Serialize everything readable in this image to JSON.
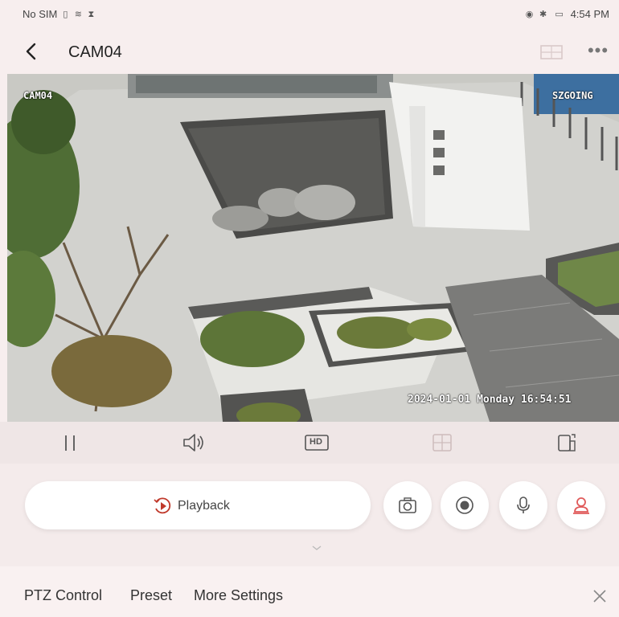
{
  "status_bar": {
    "carrier": "No SIM",
    "time": "4:54 PM"
  },
  "header": {
    "title": "CAM04",
    "more_label": "•••"
  },
  "video": {
    "osd_name": "CAM04",
    "osd_brand": "SZGOING",
    "osd_timestamp": "2024-01-01 Monday 16:54:51"
  },
  "controls": {
    "hd_label": "HD",
    "icons": [
      "pause-icon",
      "speaker-icon",
      "hd-icon",
      "grid-icon",
      "rotate-screen-icon"
    ]
  },
  "actions": {
    "playback_label": "Playback",
    "round_buttons": [
      "camera-snapshot-icon",
      "record-icon",
      "microphone-icon",
      "person-icon"
    ]
  },
  "tabs": {
    "items": [
      {
        "label": "PTZ Control"
      },
      {
        "label": "Preset"
      },
      {
        "label": "More Settings"
      }
    ],
    "active_index": 0
  },
  "colors": {
    "accent": "#e8a0a0",
    "background": "#f7eeee"
  }
}
